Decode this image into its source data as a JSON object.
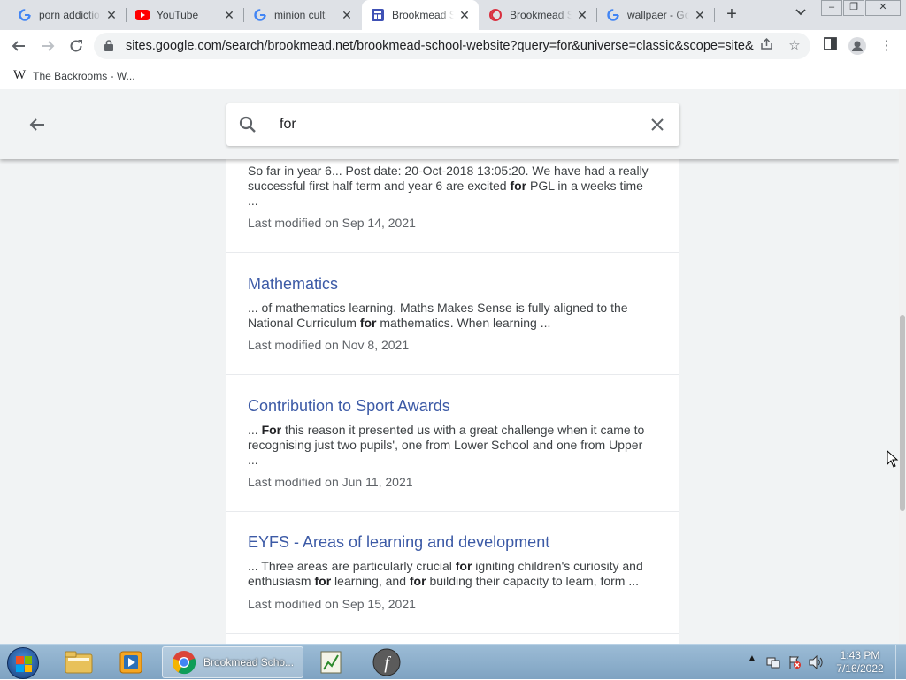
{
  "browser": {
    "tabs": [
      {
        "title": "porn addiction",
        "favicon": "google-icon"
      },
      {
        "title": "YouTube",
        "favicon": "youtube-icon"
      },
      {
        "title": "minion cult",
        "favicon": "google-icon"
      },
      {
        "title": "Brookmead School",
        "favicon": "google-sites-icon",
        "active": true
      },
      {
        "title": "Brookmead School",
        "favicon": "brookmead-icon"
      },
      {
        "title": "wallpaer - Google",
        "favicon": "google-icon"
      }
    ],
    "close_glyph": "✕",
    "new_tab_glyph": "+",
    "url": "sites.google.com/search/brookmead.net/brookmead-school-website?query=for&universe=classic&scope=site&...",
    "bookmark": {
      "label": "The Backrooms - W...",
      "icon": "W"
    }
  },
  "search": {
    "query": "for"
  },
  "results": [
    {
      "title": "",
      "snippet": [
        {
          "t": "So far in year 6... Post date: 20-Oct-2018 13:05:20. We have had a really successful first half term and year 6 are excited "
        },
        {
          "t": "for",
          "b": true
        },
        {
          "t": " PGL in a weeks time ..."
        }
      ],
      "modified": "Last modified on Sep 14, 2021"
    },
    {
      "title": "Mathematics",
      "snippet": [
        {
          "t": "... of mathematics learning. Maths Makes Sense is fully aligned to the National Curriculum "
        },
        {
          "t": "for",
          "b": true
        },
        {
          "t": " mathematics. When learning ..."
        }
      ],
      "modified": "Last modified on Nov 8, 2021"
    },
    {
      "title": "Contribution to Sport Awards",
      "snippet": [
        {
          "t": "... "
        },
        {
          "t": "For",
          "b": true
        },
        {
          "t": " this reason it presented us with a great challenge when it came to recognising just two pupils', one from Lower School and one from Upper ..."
        }
      ],
      "modified": "Last modified on Jun 11, 2021"
    },
    {
      "title": "EYFS - Areas of learning and development",
      "snippet": [
        {
          "t": "... Three areas are particularly crucial "
        },
        {
          "t": "for",
          "b": true
        },
        {
          "t": " igniting children's curiosity and enthusiasm "
        },
        {
          "t": "for",
          "b": true
        },
        {
          "t": " learning, and "
        },
        {
          "t": "for",
          "b": true
        },
        {
          "t": " building their capacity to learn, form ..."
        }
      ],
      "modified": "Last modified on Sep 15, 2021"
    }
  ],
  "taskbar": {
    "active_label": "Brookmead Scho...",
    "time": "1:43 PM",
    "date": "7/16/2022"
  },
  "colors": {
    "result_title": "#3c5aa6",
    "youtube_red": "#ff0000",
    "sites_blue": "#3f51b5",
    "brookmead_red": "#d93040"
  }
}
